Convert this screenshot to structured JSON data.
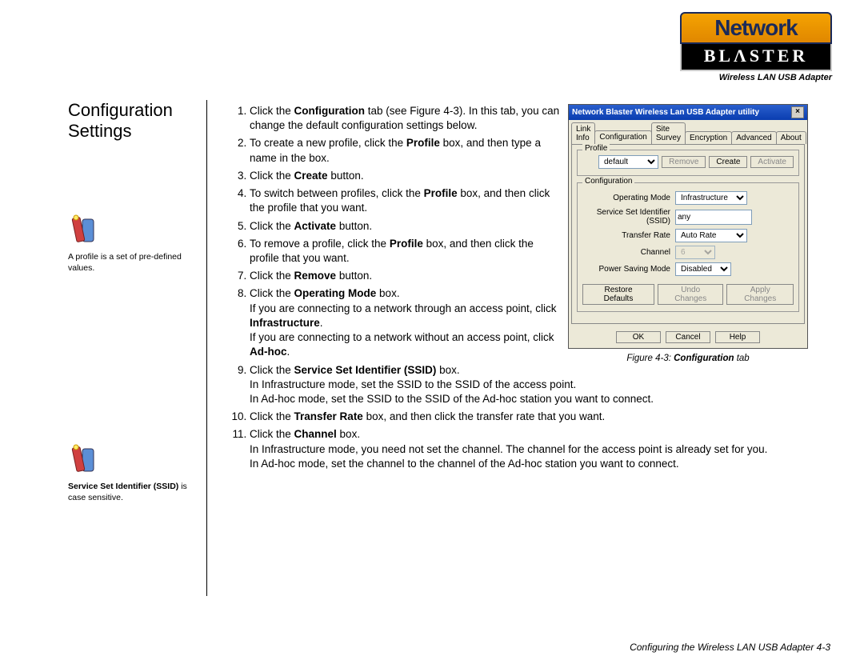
{
  "logo": {
    "top": "Network",
    "bottom": "BLΛSTER",
    "sub": "Wireless LAN USB Adapter"
  },
  "page_title": "Configuration\nSettings",
  "notes": {
    "n1": "A profile is a set of pre-defined values.",
    "n2_pre": "Service Set Identifier (SSID)",
    "n2_post": " is case sensitive."
  },
  "steps": {
    "s1_a": "Click the ",
    "s1_b": "Configuration",
    "s1_c": " tab (see Figure 4-3). In this tab, you can change the default configuration settings below.",
    "s2_a": "To create a new profile, click the ",
    "s2_b": "Profile",
    "s2_c": " box, and then type a name in the box.",
    "s3_a": "Click the ",
    "s3_b": "Create",
    "s3_c": " button.",
    "s4_a": "To switch between profiles, click the ",
    "s4_b": "Profile",
    "s4_c": " box, and then click the profile that you want.",
    "s5_a": "Click the ",
    "s5_b": "Activate",
    "s5_c": " button.",
    "s6_a": "To remove a profile, click the ",
    "s6_b": "Profile",
    "s6_c": " box, and then click the profile that you want.",
    "s7_a": "Click the ",
    "s7_b": "Remove",
    "s7_c": " button.",
    "s8_a": "Click the ",
    "s8_b": "Operating Mode",
    "s8_c": " box.",
    "s8_d": "If you are connecting to a network through an access point, click ",
    "s8_e": "Infrastructure",
    "s8_f": ".",
    "s8_g": "If you are connecting to a network without an access point, click ",
    "s8_h": "Ad-hoc",
    "s8_i": ".",
    "s9_a": "Click the ",
    "s9_b": "Service Set Identifier (SSID)",
    "s9_c": " box.",
    "s9_d": "In Infrastructure mode, set the SSID to the SSID of the access point.",
    "s9_e": "In Ad-hoc mode, set the SSID to the SSID of the Ad-hoc station you want to connect.",
    "s10_a": "Click the ",
    "s10_b": "Transfer Rate",
    "s10_c": " box, and then click the transfer rate that you want.",
    "s11_a": "Click the ",
    "s11_b": "Channel",
    "s11_c": " box.",
    "s11_d": "In Infrastructure mode, you need not set the channel. The channel  for the access point is already set for you.",
    "s11_e": "In Ad-hoc mode, set the channel to the channel of the Ad-hoc station you want to connect."
  },
  "window": {
    "title": "Network Blaster Wireless Lan USB Adapter utility",
    "tabs": [
      "Link Info",
      "Configuration",
      "Site Survey",
      "Encryption",
      "Advanced",
      "About"
    ],
    "profile_group": "Profile",
    "profile_value": "default",
    "btn_remove": "Remove",
    "btn_create": "Create",
    "btn_activate": "Activate",
    "config_group": "Configuration",
    "lbl_opmode": "Operating Mode",
    "val_opmode": "Infrastructure",
    "lbl_ssid": "Service Set Identifier (SSID)",
    "val_ssid": "any",
    "lbl_rate": "Transfer Rate",
    "val_rate": "Auto Rate",
    "lbl_channel": "Channel",
    "val_channel": "6",
    "lbl_psm": "Power Saving Mode",
    "val_psm": "Disabled",
    "btn_restore": "Restore Defaults",
    "btn_undo": "Undo Changes",
    "btn_apply": "Apply Changes",
    "btn_ok": "OK",
    "btn_cancel": "Cancel",
    "btn_help": "Help"
  },
  "figcap_a": "Figure 4-3:  ",
  "figcap_b": "Configuration",
  "figcap_c": " tab",
  "footer": "Configuring the Wireless LAN USB Adapter   4-3"
}
